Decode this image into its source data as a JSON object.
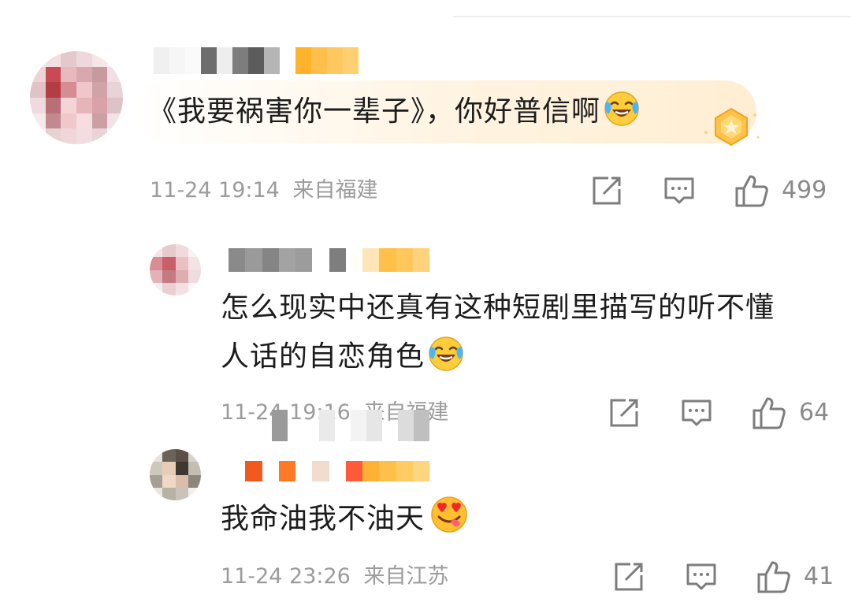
{
  "comments": [
    {
      "text": "《我要祸害你一辈子》，你好普信啊",
      "emoji": "laughing-tears-icon",
      "badge": "gold-medal-badge-icon",
      "time": "11-24 19:14",
      "location": "来自福建",
      "likes": "499"
    },
    {
      "text_line1": "怎么现实中还真有这种短剧里描写的听不懂",
      "text_line2": "人话的自恋角色",
      "emoji": "laughing-tears-icon",
      "time": "11-24 19:16",
      "location": "来自福建",
      "likes": "64"
    },
    {
      "text": "我命油我不油天",
      "emoji": "heart-eyes-tongue-icon",
      "time": "11-24 23:26",
      "location": "来自江苏",
      "likes": "41"
    }
  ],
  "icons": {
    "share": "share-icon",
    "reply": "comment-icon",
    "like": "thumbs-up-icon"
  },
  "colors": {
    "text": "#1c1c1c",
    "meta": "#9c9c9c",
    "icon": "#7d7d7d",
    "vip_badge": "#ffb42e"
  }
}
